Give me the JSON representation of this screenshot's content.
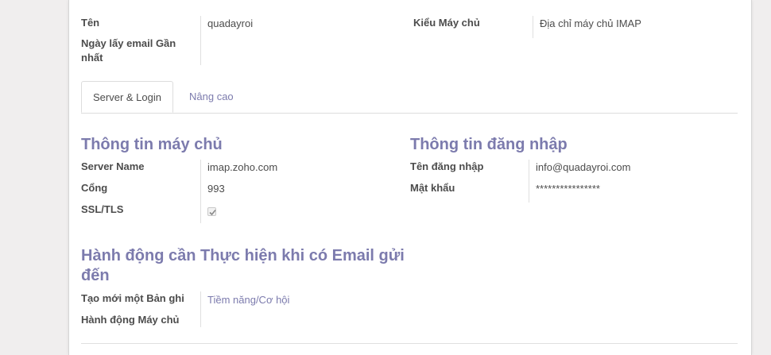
{
  "header_fields": {
    "name_label": "Tên",
    "name_value": "quadayroi",
    "last_fetch_label": "Ngày lấy email Gần nhất",
    "last_fetch_value": "",
    "server_type_label": "Kiểu Máy chủ",
    "server_type_value": "Địa chỉ máy chủ IMAP"
  },
  "tabs": [
    {
      "label": "Server & Login",
      "active": true
    },
    {
      "label": "Nâng cao",
      "active": false
    }
  ],
  "server_info": {
    "title": "Thông tin máy chủ",
    "server_name_label": "Server Name",
    "server_name_value": "imap.zoho.com",
    "port_label": "Cổng",
    "port_value": "993",
    "ssl_label": "SSL/TLS",
    "ssl_checked": true
  },
  "login_info": {
    "title": "Thông tin đăng nhập",
    "username_label": "Tên đăng nhập",
    "username_value": "info@quadayroi.com",
    "password_label": "Mật khẩu",
    "password_value": "****************"
  },
  "actions": {
    "title": "Hành động cần Thực hiện khi có Email gửi đến",
    "create_record_label": "Tạo mới một Bản ghi",
    "create_record_value": "Tiềm năng/Cơ hội",
    "server_action_label": "Hành động Máy chủ",
    "server_action_value": ""
  },
  "colors": {
    "accent": "#7c7bad",
    "text": "#4c4c4c",
    "background": "#f0eeee",
    "sheet": "#ffffff"
  }
}
